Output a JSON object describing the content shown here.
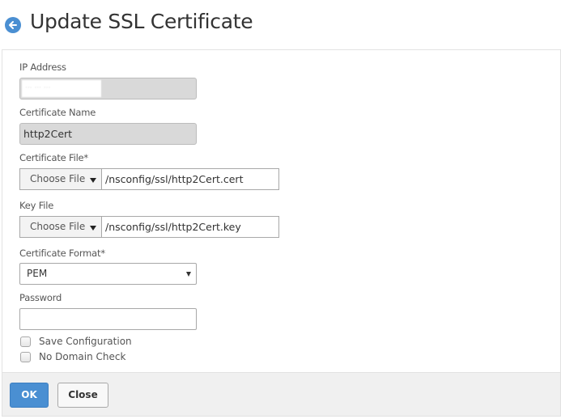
{
  "header": {
    "title": "Update SSL Certificate",
    "back_icon": "arrow-left-circle-icon",
    "accent_color": "#4a8fd2"
  },
  "form": {
    "ip_address": {
      "label": "IP Address",
      "value": "(redacted)"
    },
    "certificate_name": {
      "label": "Certificate Name",
      "value": "http2Cert"
    },
    "certificate_file": {
      "label": "Certificate File*",
      "button_label": "Choose File",
      "value": "/nsconfig/ssl/http2Cert.cert"
    },
    "key_file": {
      "label": "Key File",
      "button_label": "Choose File",
      "value": "/nsconfig/ssl/http2Cert.key"
    },
    "certificate_format": {
      "label": "Certificate Format*",
      "selected": "PEM"
    },
    "password": {
      "label": "Password",
      "value": ""
    },
    "checkboxes": [
      {
        "label": "Save Configuration",
        "checked": false
      },
      {
        "label": "No Domain Check",
        "checked": false
      }
    ]
  },
  "footer": {
    "ok_label": "OK",
    "close_label": "Close"
  }
}
